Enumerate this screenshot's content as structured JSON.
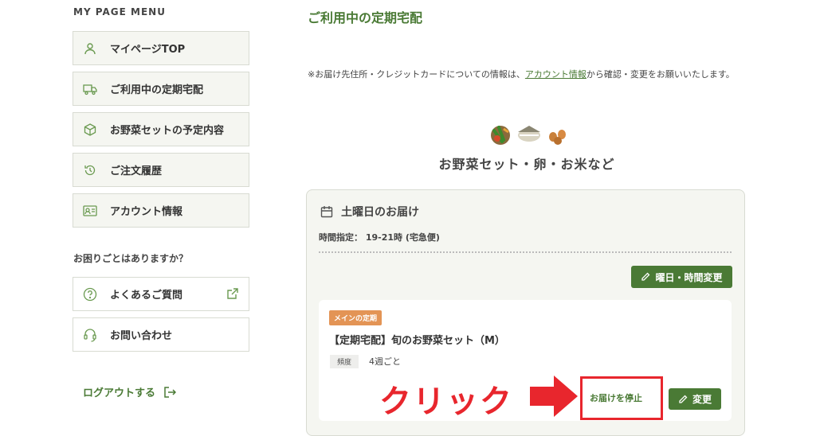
{
  "sidebar": {
    "title": "MY PAGE MENU",
    "items": [
      {
        "label": "マイページTOP",
        "icon": "person-icon"
      },
      {
        "label": "ご利用中の定期宅配",
        "icon": "truck-icon"
      },
      {
        "label": "お野菜セットの予定内容",
        "icon": "box-icon"
      },
      {
        "label": "ご注文履歴",
        "icon": "history-icon"
      },
      {
        "label": "アカウント情報",
        "icon": "id-card-icon"
      }
    ],
    "help_title": "お困りごとはありますか？",
    "help_items": [
      {
        "label": "よくあるご質問",
        "icon": "question-icon"
      },
      {
        "label": "お問い合わせ",
        "icon": "headset-icon"
      }
    ],
    "logout": "ログアウトする"
  },
  "main": {
    "title": "ご利用中の定期宅配",
    "notice_before": "※お届け先住所・クレジットカードについての情報は、",
    "notice_link": "アカウント情報",
    "notice_after": "から確認・変更をお願いいたします。",
    "category": "お野菜セット・卵・お米など",
    "delivery": {
      "day": "土曜日のお届け",
      "time": "時間指定： 19-21時 (宅急便)",
      "change_day_button": "曜日・時間変更",
      "item": {
        "tag": "メインの定期",
        "name": "【定期宅配】旬のお野菜セット（M）",
        "freq_label": "頻度",
        "freq_value": "4週ごと",
        "stop_link": "お届けを停止",
        "change_button": "変更"
      }
    }
  },
  "annotation": {
    "click_text": "クリック",
    "color": "#e8262d"
  },
  "colors": {
    "accent": "#4a7a35",
    "tag": "#e39455",
    "panel": "#f5f6f1"
  }
}
